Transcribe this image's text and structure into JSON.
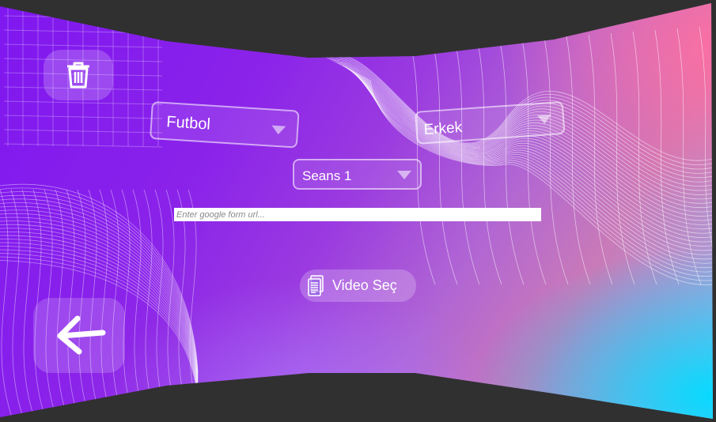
{
  "dropdowns": {
    "sport": {
      "selected": "Futbol"
    },
    "gender": {
      "selected": "Erkek"
    },
    "session": {
      "selected": "Seans 1"
    }
  },
  "form_url": {
    "value": "",
    "placeholder": "Enter google form url..."
  },
  "video_button": {
    "label": "Video Seç",
    "icon": "document-icon"
  },
  "icons": {
    "delete": "trash-icon",
    "back": "arrow-left-icon",
    "dropdown": "caret-down-icon"
  },
  "colors": {
    "gradient_purple": "#7f17f0",
    "gradient_pink": "#ff6ea0",
    "gradient_cyan": "#00dcff",
    "input_background": "#ffffff",
    "frame_background": "#303030"
  }
}
